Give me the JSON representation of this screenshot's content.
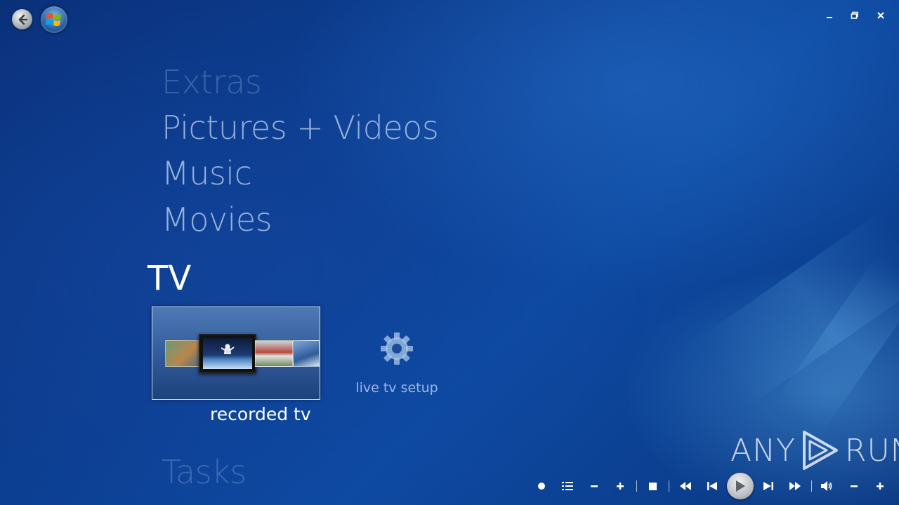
{
  "window": {
    "controls": {
      "minimize_icon": "minimize-icon",
      "restore_icon": "restore-icon",
      "close_icon": "close-icon"
    }
  },
  "menu": {
    "items": [
      {
        "label": "Extras",
        "state": "faded"
      },
      {
        "label": "Pictures + Videos",
        "state": "normal"
      },
      {
        "label": "Music",
        "state": "normal"
      },
      {
        "label": "Movies",
        "state": "normal"
      },
      {
        "label": "TV",
        "state": "selected"
      },
      {
        "label": "Tasks",
        "state": "faded"
      }
    ]
  },
  "tv_strip": {
    "tiles": [
      {
        "label": "recorded tv",
        "icon": "recorded-tv-thumbnails",
        "focused": true
      },
      {
        "label": "live tv setup",
        "icon": "gear-icon",
        "focused": false
      }
    ]
  },
  "watermark": {
    "text_left": "ANY",
    "text_right": "RUN"
  },
  "transport": {
    "buttons": [
      "record",
      "guide",
      "channel-down",
      "channel-up",
      "stop",
      "rewind",
      "skip-back",
      "play",
      "skip-forward",
      "fast-forward",
      "mute",
      "volume-down",
      "volume-up"
    ]
  },
  "colors": {
    "background": "#0b3d8f",
    "text": "#ffffff"
  }
}
